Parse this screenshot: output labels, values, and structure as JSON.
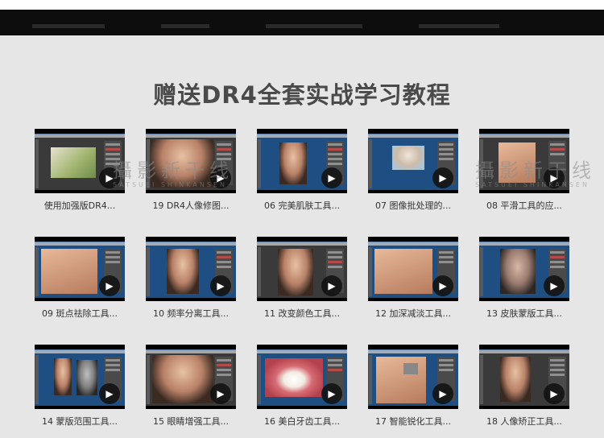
{
  "title": "赠送DR4全套实战学习教程",
  "watermark": {
    "text": "攝影新干线",
    "sub": "SATSUEI SHINKANSEN"
  },
  "play_icon": "▶",
  "videos": [
    {
      "label": "使用加强版DR4..."
    },
    {
      "label": "19 DR4人像修图..."
    },
    {
      "label": "06 完美肌肤工具..."
    },
    {
      "label": "07 图像批处理的..."
    },
    {
      "label": "08 平滑工具的应..."
    },
    {
      "label": "09 斑点祛除工具..."
    },
    {
      "label": "10 频率分离工具..."
    },
    {
      "label": "11 改变颜色工具..."
    },
    {
      "label": "12 加深减淡工具..."
    },
    {
      "label": "13 皮肤蒙版工具..."
    },
    {
      "label": "14 蒙版范围工具..."
    },
    {
      "label": "15 眼睛增强工具..."
    },
    {
      "label": "16 美白牙齿工具..."
    },
    {
      "label": "17 智能锐化工具..."
    },
    {
      "label": "18 人像矫正工具..."
    }
  ]
}
